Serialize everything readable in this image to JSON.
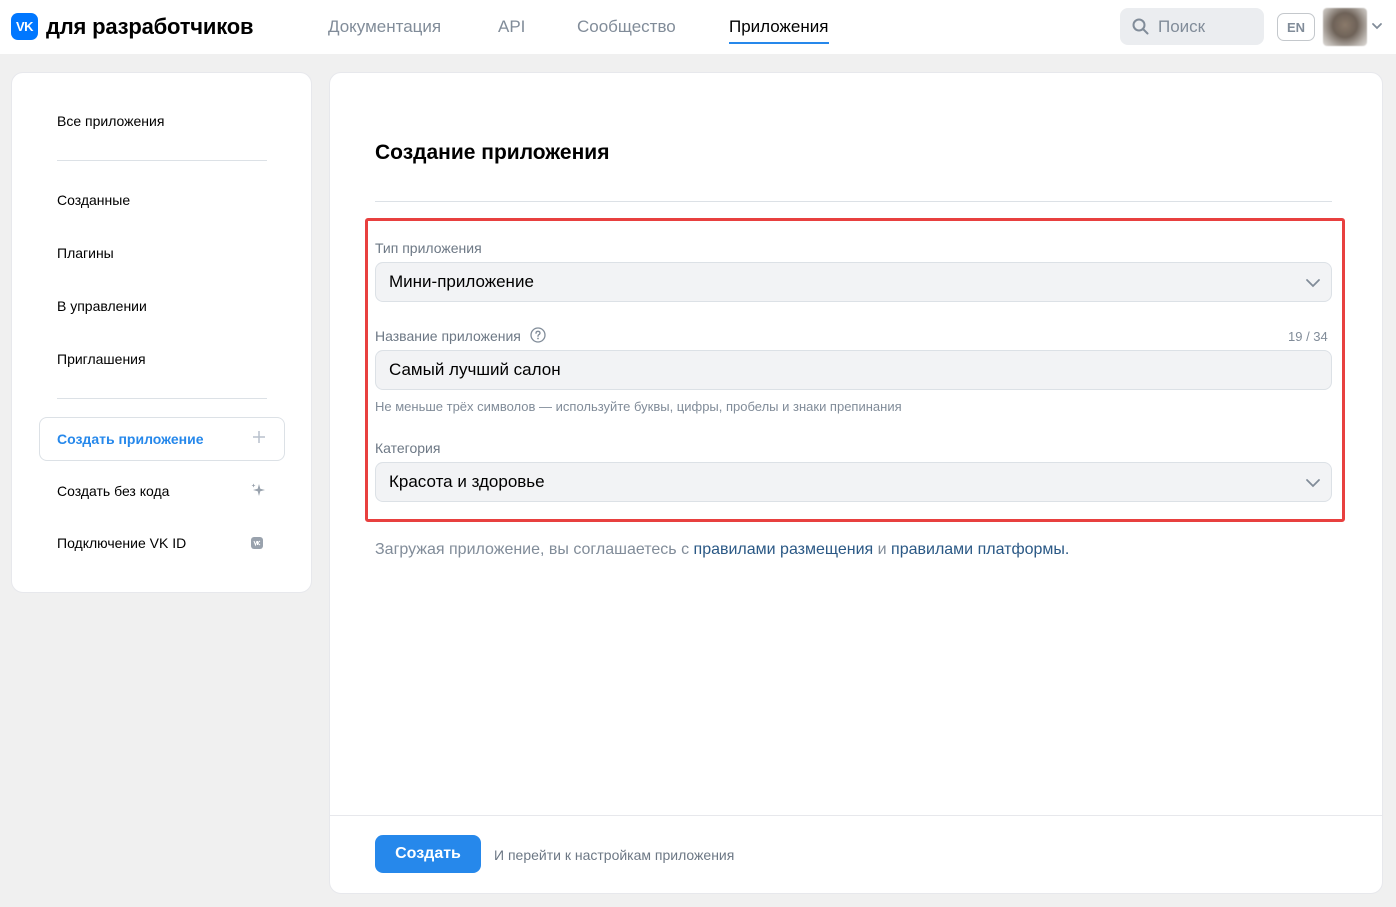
{
  "header": {
    "logo_badge": "VK",
    "logo_text": "для разработчиков",
    "nav": [
      "Документация",
      "API",
      "Сообщество",
      "Приложения"
    ],
    "active_nav": "Приложения",
    "search_placeholder": "Поиск",
    "lang": "EN"
  },
  "sidebar": {
    "items": [
      {
        "label": "Все приложения"
      },
      {
        "label": "Созданные"
      },
      {
        "label": "Плагины"
      },
      {
        "label": "В управлении"
      },
      {
        "label": "Приглашения"
      },
      {
        "label": "Создать приложение",
        "active": true
      },
      {
        "label": "Создать без кода"
      },
      {
        "label": "Подключение VK ID"
      }
    ]
  },
  "main": {
    "title": "Создание приложения",
    "type_label": "Тип приложения",
    "type_value": "Мини-приложение",
    "name_label": "Название приложения",
    "name_value": "Самый лучший салон",
    "name_counter": "19 / 34",
    "name_hint": "Не меньше трёх символов — используйте буквы, цифры, пробелы и знаки препинания",
    "category_label": "Категория",
    "category_value": "Красота и здоровье",
    "terms_prefix": "Загружая приложение, вы соглашаетесь с ",
    "terms_link1": "правилами размещения",
    "terms_mid": " и ",
    "terms_link2": "правилами платформы",
    "terms_suffix": ".",
    "create_button": "Создать",
    "footer_note": "И перейти к настройкам приложения"
  },
  "colors": {
    "accent": "#2688eb",
    "highlight": "#e8403f",
    "link": "#2a5885"
  }
}
